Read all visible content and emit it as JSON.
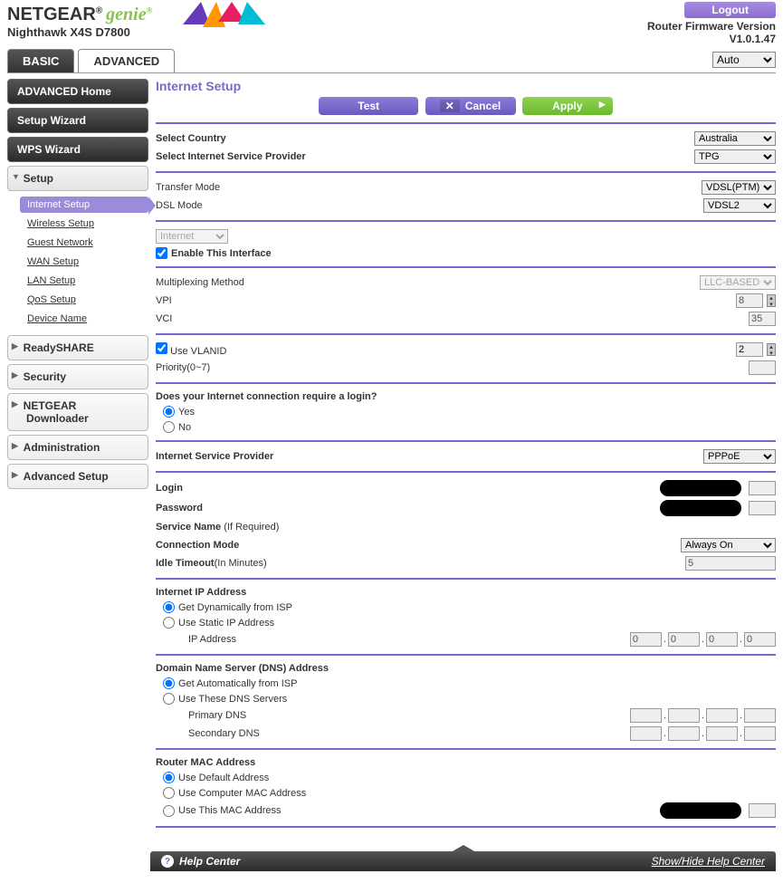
{
  "brand": {
    "netgear": "NETGEAR",
    "genie": "genie"
  },
  "model": "Nighthawk X4S D7800",
  "header": {
    "logout": "Logout",
    "fw_label": "Router Firmware Version",
    "fw_ver": "V1.0.1.47"
  },
  "tabs": {
    "basic": "BASIC",
    "advanced": "ADVANCED",
    "refresh": "Auto"
  },
  "sidebar": {
    "adv_home": "ADVANCED Home",
    "setup_wizard": "Setup Wizard",
    "wps_wizard": "WPS Wizard",
    "setup": "Setup",
    "setup_items": {
      "internet": "Internet Setup",
      "wireless": "Wireless Setup",
      "guest": "Guest Network",
      "wan": "WAN Setup",
      "lan": "LAN Setup",
      "qos": "QoS Setup",
      "device": "Device Name"
    },
    "readyshare": "ReadySHARE",
    "security": "Security",
    "downloader_l1": "NETGEAR",
    "downloader_l2": "Downloader",
    "admin": "Administration",
    "adv_setup": "Advanced Setup"
  },
  "page": {
    "title": "Internet Setup",
    "test": "Test",
    "cancel": "Cancel",
    "apply": "Apply"
  },
  "form": {
    "country_label": "Select Country",
    "country": "Australia",
    "isp_label": "Select Internet Service Provider",
    "isp": "TPG",
    "transfer_mode_label": "Transfer Mode",
    "transfer_mode": "VDSL(PTM)",
    "dsl_mode_label": "DSL Mode",
    "dsl_mode": "VDSL2",
    "iface_sel": "Internet",
    "enable_iface_label": "Enable This Interface",
    "mux_label": "Multiplexing Method",
    "mux": "LLC-BASED",
    "vpi_label": "VPI",
    "vpi": "8",
    "vci_label": "VCI",
    "vci": "35",
    "vlan_label": "Use VLANID",
    "vlan": "2",
    "priority_label": "Priority(0~7)",
    "priority": "",
    "login_q": "Does your Internet connection require a login?",
    "yes": "Yes",
    "no": "No",
    "isp2_label": "Internet Service Provider",
    "isp2": "PPPoE",
    "login_label": "Login",
    "pw_label": "Password",
    "svc_label": "Service Name",
    "svc_sub": "(If Required)",
    "conn_mode_label": "Connection Mode",
    "conn_mode": "Always On",
    "idle_label": "Idle Timeout",
    "idle_sub": "(In Minutes)",
    "idle": "5",
    "ip_head": "Internet IP Address",
    "ip_dyn": "Get Dynamically from ISP",
    "ip_static": "Use Static IP Address",
    "ip_addr_label": "IP Address",
    "ip_zero": "0",
    "dns_head": "Domain Name Server (DNS) Address",
    "dns_auto": "Get Automatically from ISP",
    "dns_use": "Use These DNS Servers",
    "dns_pri": "Primary DNS",
    "dns_sec": "Secondary DNS",
    "mac_head": "Router MAC Address",
    "mac_def": "Use Default Address",
    "mac_comp": "Use Computer MAC Address",
    "mac_this": "Use This MAC Address"
  },
  "footer": {
    "help": "Help Center",
    "toggle": "Show/Hide Help Center"
  }
}
